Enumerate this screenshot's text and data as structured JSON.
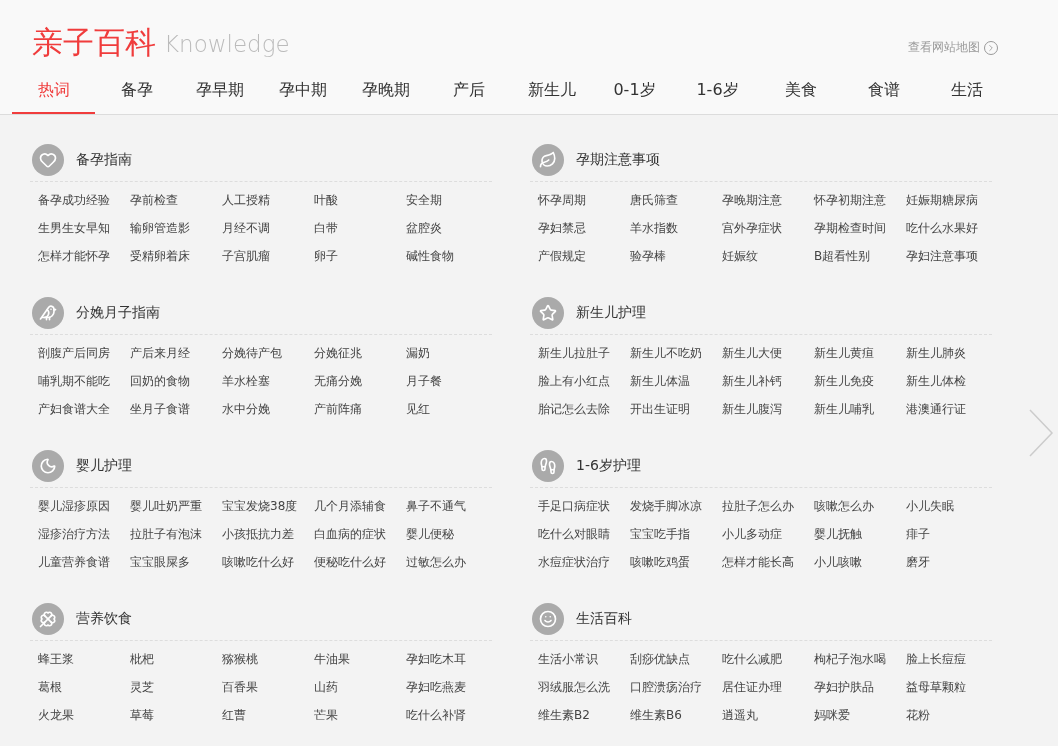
{
  "header": {
    "title": "亲子百科",
    "subtitle": "Knowledge",
    "sitemap_link": "查看网站地图"
  },
  "tabs": [
    {
      "label": "热词",
      "selected": true
    },
    {
      "label": "备孕",
      "selected": false
    },
    {
      "label": "孕早期",
      "selected": false
    },
    {
      "label": "孕中期",
      "selected": false
    },
    {
      "label": "孕晚期",
      "selected": false
    },
    {
      "label": "产后",
      "selected": false
    },
    {
      "label": "新生儿",
      "selected": false
    },
    {
      "label": "0-1岁",
      "selected": false
    },
    {
      "label": "1-6岁",
      "selected": false
    },
    {
      "label": "美食",
      "selected": false
    },
    {
      "label": "食谱",
      "selected": false
    },
    {
      "label": "生活",
      "selected": false
    }
  ],
  "sections": [
    {
      "title": "备孕指南",
      "items": [
        "备孕成功经验",
        "孕前检查",
        "人工授精",
        "叶酸",
        "安全期",
        "生男生女早知",
        "输卵管造影",
        "月经不调",
        "白带",
        "盆腔炎",
        "怎样才能怀孕",
        "受精卵着床",
        "子宫肌瘤",
        "卵子",
        "碱性食物"
      ]
    },
    {
      "title": "孕期注意事项",
      "items": [
        "怀孕周期",
        "唐氏筛查",
        "孕晚期注意",
        "怀孕初期注意",
        "妊娠期糖尿病",
        "孕妇禁忌",
        "羊水指数",
        "宫外孕症状",
        "孕期检查时间",
        "吃什么水果好",
        "产假规定",
        "验孕棒",
        "妊娠纹",
        "B超看性别",
        "孕妇注意事项"
      ]
    },
    {
      "title": "分娩月子指南",
      "items": [
        "剖腹产后同房",
        "产后来月经",
        "分娩待产包",
        "分娩征兆",
        "漏奶",
        "哺乳期不能吃",
        "回奶的食物",
        "羊水栓塞",
        "无痛分娩",
        "月子餐",
        "产妇食谱大全",
        "坐月子食谱",
        "水中分娩",
        "产前阵痛",
        "见红"
      ]
    },
    {
      "title": "新生儿护理",
      "items": [
        "新生儿拉肚子",
        "新生儿不吃奶",
        "新生儿大便",
        "新生儿黄疸",
        "新生儿肺炎",
        "脸上有小红点",
        "新生儿体温",
        "新生儿补钙",
        "新生儿免疫",
        "新生儿体检",
        "胎记怎么去除",
        "开出生证明",
        "新生儿腹泻",
        "新生儿哺乳",
        "港澳通行证"
      ]
    },
    {
      "title": "婴儿护理",
      "items": [
        "婴儿湿疹原因",
        "婴儿吐奶严重",
        "宝宝发烧38度",
        "几个月添辅食",
        "鼻子不通气",
        "湿疹治疗方法",
        "拉肚子有泡沫",
        "小孩抵抗力差",
        "白血病的症状",
        "婴儿便秘",
        "儿童营养食谱",
        "宝宝眼屎多",
        "咳嗽吃什么好",
        "便秘吃什么好",
        "过敏怎么办"
      ]
    },
    {
      "title": "1-6岁护理",
      "items": [
        "手足口病症状",
        "发烧手脚冰凉",
        "拉肚子怎么办",
        "咳嗽怎么办",
        "小儿失眠",
        "吃什么对眼睛",
        "宝宝吃手指",
        "小儿多动症",
        "婴儿抚触",
        "痱子",
        "水痘症状治疗",
        "咳嗽吃鸡蛋",
        "怎样才能长高",
        "小儿咳嗽",
        "磨牙"
      ]
    },
    {
      "title": "营养饮食",
      "items": [
        "蜂王浆",
        "枇杷",
        "猕猴桃",
        "牛油果",
        "孕妇吃木耳",
        "葛根",
        "灵芝",
        "百香果",
        "山药",
        "孕妇吃燕麦",
        "火龙果",
        "草莓",
        "红曹",
        "芒果",
        "吃什么补肾"
      ]
    },
    {
      "title": "生活百科",
      "items": [
        "生活小常识",
        "刮痧优缺点",
        "吃什么减肥",
        "枸杞子泡水喝",
        "脸上长痘痘",
        "羽绒服怎么洗",
        "口腔溃疡治疗",
        "居住证办理",
        "孕妇护肤品",
        "益母草颗粒",
        "维生素B2",
        "维生素B6",
        "逍遥丸",
        "妈咪爱",
        "花粉"
      ]
    }
  ]
}
